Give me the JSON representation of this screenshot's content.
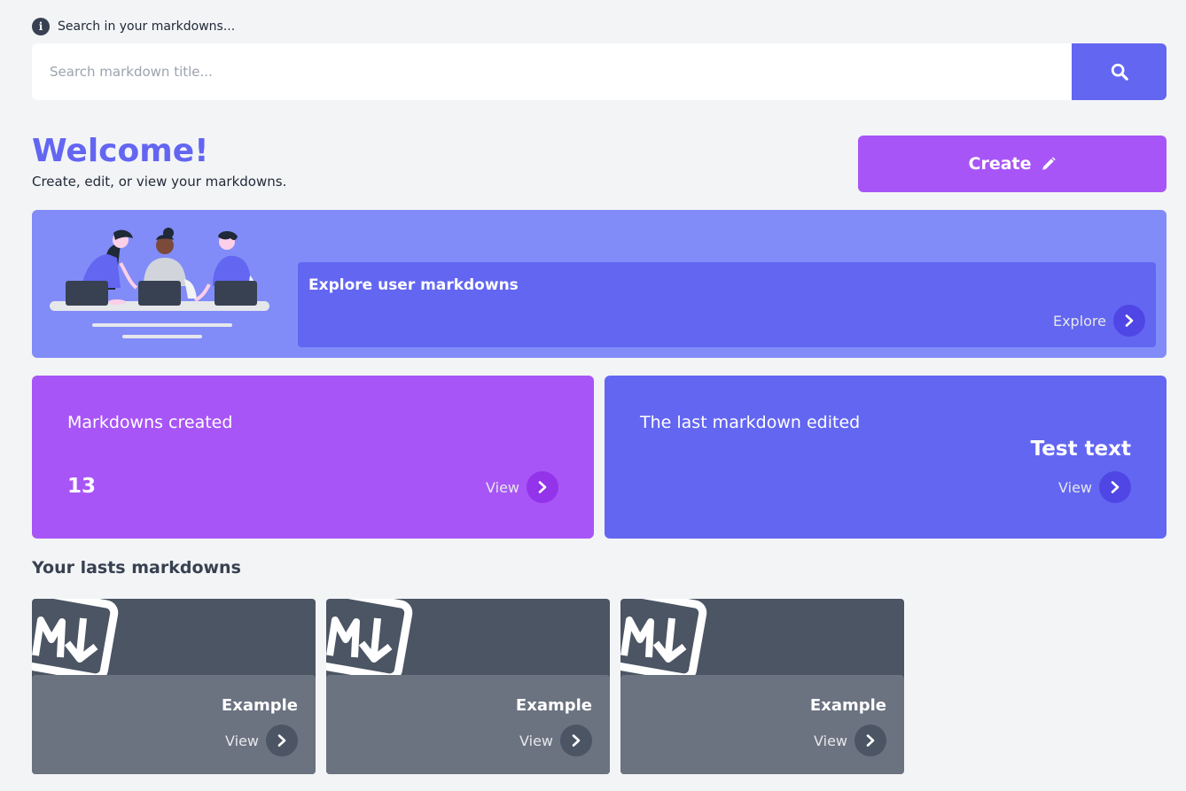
{
  "search": {
    "hint": "Search in your markdowns...",
    "placeholder": "Search markdown title...",
    "info_icon": "info-icon",
    "button_icon": "search-icon"
  },
  "welcome": {
    "title": "Welcome!",
    "subtitle": "Create, edit, or view your markdowns."
  },
  "create_button": {
    "label": "Create",
    "icon": "pencil-icon"
  },
  "explore": {
    "title": "Explore user markdowns",
    "link_label": "Explore"
  },
  "stats": {
    "created": {
      "label": "Markdowns created",
      "value": "13",
      "link_label": "View"
    },
    "last_edited": {
      "label": "The last markdown edited",
      "title": "Test text",
      "link_label": "View"
    }
  },
  "lasts": {
    "title": "Your lasts markdowns",
    "items": [
      {
        "title": "Example",
        "link_label": "View"
      },
      {
        "title": "Example",
        "link_label": "View"
      },
      {
        "title": "Example",
        "link_label": "View"
      }
    ]
  },
  "colors": {
    "primary": "#6366f1",
    "purple": "#a855f7",
    "banner": "#818cf8",
    "card_dark": "#4b5563",
    "card_body": "#6b7280",
    "background": "#f3f4f6"
  }
}
